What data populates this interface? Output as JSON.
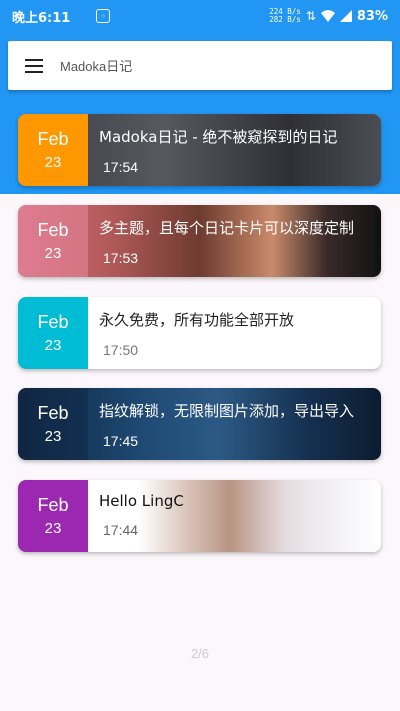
{
  "status": {
    "time": "晚上6:11",
    "net_up": "224 B/s",
    "net_down": "282 B/s",
    "battery": "83%"
  },
  "search": {
    "title": "Madoka日记"
  },
  "cards": [
    {
      "month": "Feb",
      "day": "23",
      "title": "Madoka日记 - 绝不被窥探到的日记",
      "time": "17:54",
      "date_color": "#ff9800"
    },
    {
      "month": "Feb",
      "day": "23",
      "title": "多主题，且每个日记卡片可以深度定制",
      "time": "17:53",
      "date_color": "#e8889a"
    },
    {
      "month": "Feb",
      "day": "23",
      "title": "永久免费，所有功能全部开放",
      "time": "17:50",
      "date_color": "#00bcd4"
    },
    {
      "month": "Feb",
      "day": "23",
      "title": "指纹解锁，无限制图片添加，导出导入",
      "time": "17:45",
      "date_color": "#16365c"
    },
    {
      "month": "Feb",
      "day": "23",
      "title": "Hello LingC",
      "time": "17:44",
      "date_color": "#9c27b0"
    }
  ],
  "pager": "2/6"
}
